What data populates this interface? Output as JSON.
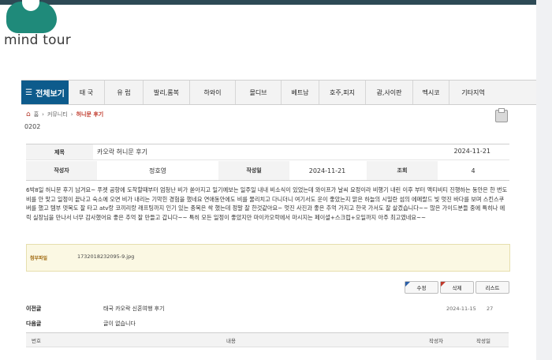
{
  "logo": {
    "text": "mind tour",
    "brand_color": "#1f8a7a"
  },
  "nav": {
    "all_label": "전체보기",
    "items": [
      "태 국",
      "유 럽",
      "발리,롬복",
      "하와이",
      "몰디브",
      "베트남",
      "호주,피지",
      "괌,사이판",
      "멕시코",
      "기타지역"
    ]
  },
  "breadcrumb": {
    "home": "홈",
    "community": "커뮤니티",
    "current": "허니문 후기"
  },
  "code": "0202",
  "post": {
    "title_label": "제목",
    "title": "카오락 허니문 후기",
    "title_date": "2024-11-21",
    "author_label": "작성자",
    "author": "정호영",
    "date_label": "작성일",
    "date": "2024-11-21",
    "views_label": "조회",
    "views": "4",
    "body": "6박8일 허니문 후기 남겨요~ 푸켓 공항에 도착할때부터 엄청난 비가 쏟아지고 일기예보는 일주일 내내 비소식이 있었는데 와이프가 날씨 요정이라 비행기 내린 이후 부터 액티비티 진행하는 동안은 한 번도 비를 안 맞고 일정이 끝나고 숙소에 오면 비가 내리는 기막힌 경험을 했네요 연애동안에도 비를 물리치고 다니더니 여기서도 운이 좋았는지 맑은 하늘의 시밀란 섬의 에메랄드 빛 멋진 바다를 보며 스킨스쿠버를 했고 템부 뎃목도 잘 타고 atv랑 코끼리랑 래프팅까지 인기 있는 종목은 싹 했는데 정말 잘 한것같아요~ 멋진 사진과 좋은 추억 가지고 한국 가서도 잘 살겠습니다~~ 많은 가이드분들 중에 특히나 에릭 실장님을 만나서 너무 감사했어요 좋은 추억 잘 만들고 갑니다~~ 특히 모든 일정이 좋았지만 마이카오락에서 마시지는 페이셜+스크럽+오일까지 아주 최고였네요~~",
    "attach_label": "첨부파일",
    "attach_file": "1732018232095-9.jpg"
  },
  "buttons": {
    "edit": "수정",
    "delete": "삭제",
    "list": "리스트"
  },
  "prev": {
    "label": "이전글",
    "title": "태국 카오락 신혼여행 후기",
    "date": "2024-11-15",
    "views": "27"
  },
  "next": {
    "label": "다음글",
    "title": "글이 없습니다"
  },
  "list_headers": {
    "no": "번호",
    "content": "내용",
    "author": "작성자",
    "date": "작성일"
  }
}
